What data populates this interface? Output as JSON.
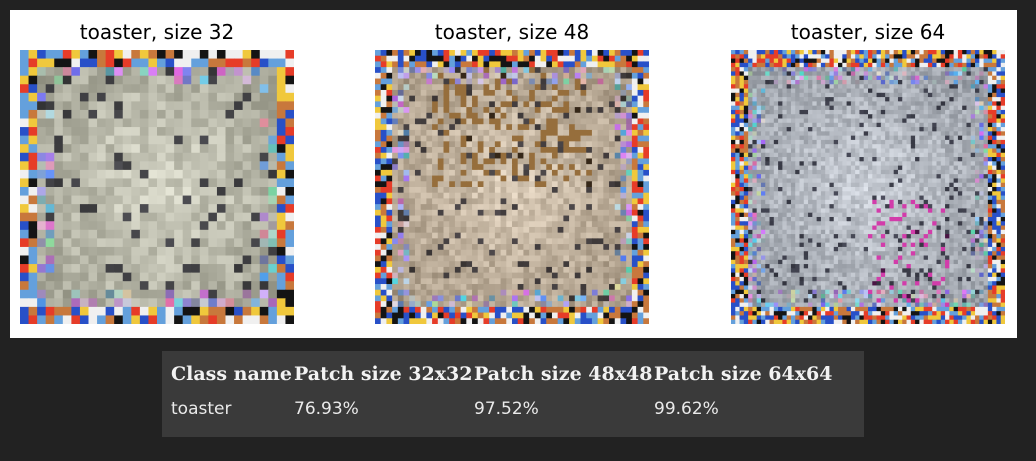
{
  "figure": {
    "panels": [
      {
        "title": "toaster, size 32",
        "grid": 32,
        "palette": "blocky"
      },
      {
        "title": "toaster, size 48",
        "grid": 48,
        "palette": "warm"
      },
      {
        "title": "toaster, size 64",
        "grid": 64,
        "palette": "cool"
      }
    ]
  },
  "table": {
    "headers": [
      "Class name",
      "Patch size 32x32",
      "Patch size 48x48",
      "Patch size 64x64"
    ],
    "rows": [
      [
        "toaster",
        "76.93%",
        "97.52%",
        "99.62%"
      ]
    ]
  }
}
